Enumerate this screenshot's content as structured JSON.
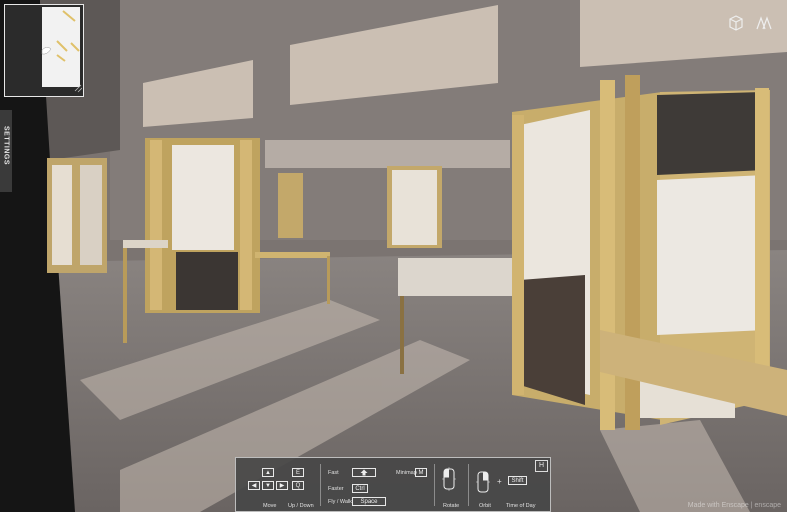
{
  "sidebar": {
    "settings_label": "SETTINGS"
  },
  "help_panel": {
    "toggle_key": "H",
    "move_keys": [
      "▲",
      "◀",
      "▼",
      "▶"
    ],
    "updown_keys": [
      "E",
      "Q"
    ],
    "move_label": "Move",
    "updown_label": "Up / Down",
    "fast_label": "Fast",
    "faster_label": "Faster",
    "faster_key": "Ctrl",
    "flywalk_label": "Fly  /  Walk",
    "flywalk_key": "Space",
    "minimap_label": "Minimap",
    "minimap_key": "M",
    "rotate_label": "Rotate",
    "orbit_label": "Orbit",
    "plus": "+",
    "timeofday_key": "Shift",
    "timeofday_label": "Time of Day"
  },
  "watermark": "Made with Enscape | enscape",
  "icons": [
    "cube-view-icon",
    "walk-mode-icon",
    "mouse-icon",
    "shift-icon"
  ]
}
